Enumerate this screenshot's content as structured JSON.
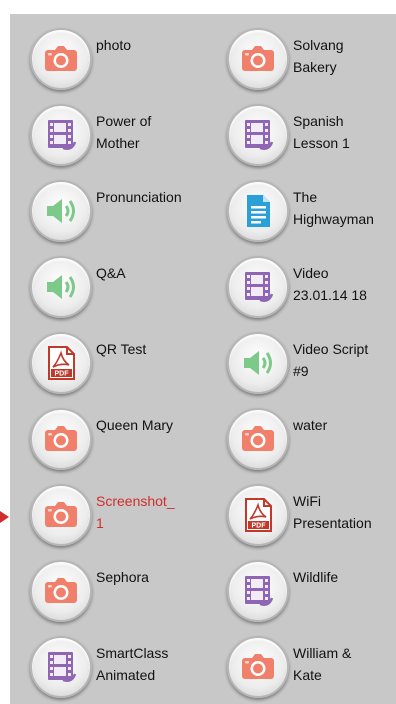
{
  "colors": {
    "panel_bg": "#c8c8c8",
    "camera": "#f0806c",
    "video": "#8f66b3",
    "audio": "#7dc98a",
    "pdf": "#c0392b",
    "doc": "#2a9fd8",
    "selected_text": "#d12d2d"
  },
  "items": [
    {
      "label": "photo",
      "icon": "camera-icon"
    },
    {
      "label": "Solvang\nBakery",
      "icon": "camera-icon"
    },
    {
      "label": "Power of\nMother",
      "icon": "video-icon"
    },
    {
      "label": "Spanish\nLesson 1",
      "icon": "video-icon"
    },
    {
      "label": "Pronunciation",
      "icon": "audio-icon"
    },
    {
      "label": "The\nHighwayman",
      "icon": "document-icon"
    },
    {
      "label": "Q&A",
      "icon": "audio-icon"
    },
    {
      "label": "Video\n23.01.14 18",
      "icon": "video-icon"
    },
    {
      "label": "QR Test",
      "icon": "pdf-icon",
      "icon_text": "PDF"
    },
    {
      "label": "Video Script\n#9",
      "icon": "audio-icon"
    },
    {
      "label": "Queen Mary",
      "icon": "camera-icon"
    },
    {
      "label": "water",
      "icon": "camera-icon"
    },
    {
      "label": "Screenshot_\n1",
      "icon": "camera-icon",
      "selected": true
    },
    {
      "label": "WiFi\nPresentation",
      "icon": "pdf-icon",
      "icon_text": "PDF"
    },
    {
      "label": "Sephora",
      "icon": "camera-icon"
    },
    {
      "label": "Wildlife",
      "icon": "video-icon"
    },
    {
      "label": "SmartClass\nAnimated",
      "icon": "video-icon"
    },
    {
      "label": "William &\nKate",
      "icon": "camera-icon"
    }
  ]
}
